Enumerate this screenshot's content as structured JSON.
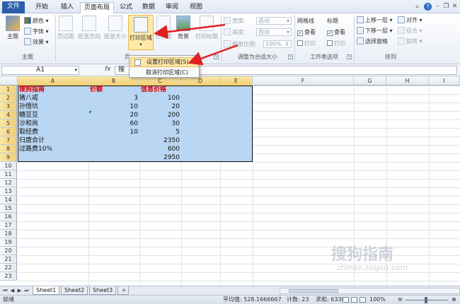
{
  "tabs": [
    "文件",
    "开始",
    "插入",
    "页面布局",
    "公式",
    "数据",
    "审阅",
    "视图"
  ],
  "active_tab": "页面布局",
  "ribbon": {
    "themes": {
      "big_label": "主题",
      "colors": "颜色",
      "fonts": "字体",
      "effects": "效果",
      "group_title": "主题"
    },
    "page_setup": {
      "margins": "页边距",
      "orientation": "纸张方向",
      "size": "纸张大小",
      "print_area": "打印区域",
      "breaks": "分隔符",
      "background": "背景",
      "print_titles": "打印标题",
      "group_title": "页"
    },
    "scale": {
      "width_label": "宽度:",
      "width_value": "自动",
      "height_label": "高度:",
      "height_value": "自动",
      "scale_label": "缩放比例:",
      "scale_value": "100%",
      "group_title": "调整为合适大小"
    },
    "sheet_options": {
      "gridlines": "网格线",
      "headings": "标题",
      "view": "查看",
      "print": "打印",
      "group_title": "工作表选项"
    },
    "arrange": {
      "bring_forward": "上移一层",
      "send_backward": "下移一层",
      "selection_pane": "选择窗格",
      "align": "对齐",
      "group": "组合",
      "rotate": "旋转",
      "group_title": "排列"
    }
  },
  "menu": {
    "set_print_area": "设置打印区域(S)",
    "clear_print_area": "取消打印区域(C)"
  },
  "formula_bar": {
    "name_box": "A1",
    "fx": "fx",
    "content": "搜"
  },
  "columns": [
    "A",
    "B",
    "C",
    "D",
    "E",
    "F",
    "G",
    "H",
    "I"
  ],
  "rows": [
    "1",
    "2",
    "3",
    "4",
    "5",
    "6",
    "7",
    "8",
    "9",
    "10",
    "11",
    "12",
    "13",
    "14",
    "15",
    "16",
    "17",
    "18",
    "19",
    "20",
    "21",
    "22",
    "23"
  ],
  "sheet": {
    "header": [
      "搜狗指南",
      "价额",
      "信息价格"
    ],
    "data": [
      [
        "猪八戒",
        "3",
        "100"
      ],
      [
        "孙悟坑",
        "10",
        "20"
      ],
      [
        "糖豆豆",
        "20",
        "200"
      ],
      [
        "沙和尚",
        "60",
        "30"
      ],
      [
        "取经费",
        "10",
        "5"
      ],
      [
        "归唐合计",
        "",
        "2350"
      ],
      [
        "过路费10%",
        "",
        "600"
      ],
      [
        "",
        "",
        "2950"
      ]
    ]
  },
  "sheet_tabs": [
    "Sheet1",
    "Sheet2",
    "Sheet3"
  ],
  "status": {
    "ready": "就绪",
    "average": "平均值: 528.1666667",
    "count": "计数: 23",
    "sum": "求和: 6338",
    "zoom": "100%"
  },
  "watermark": {
    "brand": "搜狗指南",
    "url": "zhinan.sogou.com"
  },
  "colors": {
    "file_tab": "#2b5fa8",
    "selection": "#b9d6f3",
    "header_red": "#e00000",
    "arrow": "#e02020",
    "highlight": "#fde6a6"
  }
}
